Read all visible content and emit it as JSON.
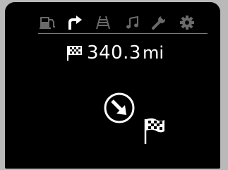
{
  "tabs": [
    {
      "icon": "fuel-station-icon",
      "active": false
    },
    {
      "icon": "turn-right-icon",
      "active": true
    },
    {
      "icon": "road-icon",
      "active": false
    },
    {
      "icon": "music-note-icon",
      "active": false
    },
    {
      "icon": "wrench-icon",
      "active": false
    },
    {
      "icon": "gear-icon",
      "active": false
    }
  ],
  "distance": {
    "value": "340.3",
    "unit": "mi",
    "icon": "checkered-flag-icon"
  },
  "guidance": {
    "arrow_icon": "arrow-down-right-icon",
    "destination_icon": "checkered-flag-icon"
  },
  "colors": {
    "background": "#000000",
    "active_icon": "#ffffff",
    "inactive_icon": "#6a6a6a",
    "text": "#ffffff"
  }
}
